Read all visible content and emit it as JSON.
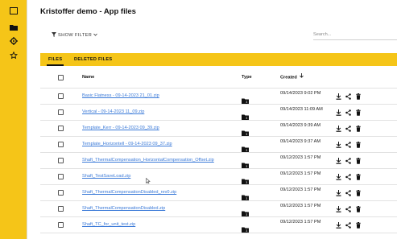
{
  "app": {
    "title": "Kristoffer demo - App files"
  },
  "sidebar": {
    "icons": [
      "collapse-panel-icon",
      "folder-icon",
      "gear-icon",
      "star-icon"
    ]
  },
  "toolbar": {
    "filter_label": "SHOW FILTER",
    "search_placeholder": "Search..."
  },
  "tabs": [
    {
      "label": "FILES",
      "active": true
    },
    {
      "label": "DELETED FILES",
      "active": false
    }
  ],
  "table": {
    "columns": {
      "name": "Name",
      "type": "Type",
      "created": "Created"
    },
    "sort": {
      "column": "created",
      "direction": "descending",
      "icon": "arrow-down-icon"
    },
    "rows": [
      {
        "name": "Basic Flatness - 09-14-2023 21_01.zip",
        "created": "09/14/2023 9:02 PM"
      },
      {
        "name": "Vertical - 09-14-2023 11_09.zip",
        "created": "09/14/2023 11:09 AM"
      },
      {
        "name": "Template_Kerr - 09-14-2023 09_39.zip",
        "created": "09/14/2023 9:39 AM"
      },
      {
        "name": "Template_Horizontell - 09-14-2023 09_37.zip",
        "created": "09/14/2023 9:37 AM"
      },
      {
        "name": "Shaft_ThermalCompensation_HorizontalCompensation_Offset.zip",
        "created": "09/12/2023 1:57 PM"
      },
      {
        "name": "Shaft_TestSaveLoad.zip",
        "created": "09/12/2023 1:57 PM"
      },
      {
        "name": "Shaft_ThermalCompensationDisabled_rev0.zip",
        "created": "09/12/2023 1:57 PM"
      },
      {
        "name": "Shaft_ThermalCompensationDisabled.zip",
        "created": "09/12/2023 1:57 PM"
      },
      {
        "name": "Shaft_TC_for_unit_test.zip",
        "created": "09/12/2023 1:57 PM"
      }
    ],
    "row_actions": [
      "download-icon",
      "share-icon",
      "trash-icon"
    ],
    "type_icon": "folder-icon"
  },
  "colors": {
    "accent": "#f5c518",
    "link": "#3b7ad8",
    "text": "#222222"
  }
}
